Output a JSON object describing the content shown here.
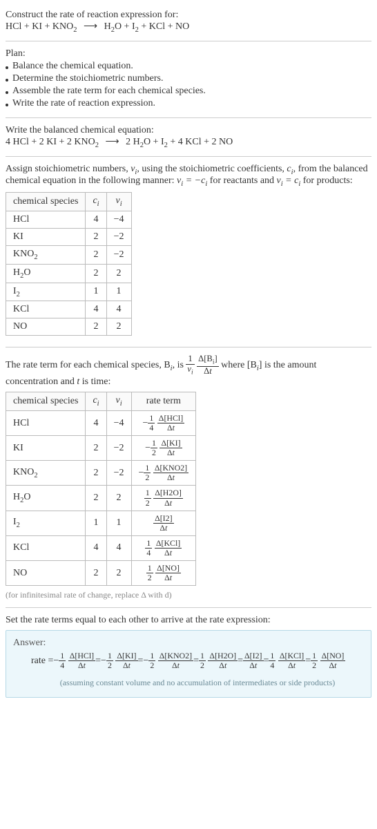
{
  "header": {
    "prompt": "Construct the rate of reaction expression for:",
    "equation_left": "HCl + KI + KNO",
    "equation_left_sub": "2",
    "equation_right_pre": "H",
    "equation_right_sub1": "2",
    "equation_right_mid1": "O + I",
    "equation_right_sub2": "2",
    "equation_right_mid2": " + KCl + NO"
  },
  "plan": {
    "title": "Plan:",
    "items": [
      "Balance the chemical equation.",
      "Determine the stoichiometric numbers.",
      "Assemble the rate term for each chemical species.",
      "Write the rate of reaction expression."
    ]
  },
  "balanced": {
    "title": "Write the balanced chemical equation:",
    "left": "4 HCl + 2 KI + 2 KNO",
    "left_sub": "2",
    "right_pre": "2 H",
    "right_sub1": "2",
    "right_mid1": "O + I",
    "right_sub2": "2",
    "right_mid2": " + 4 KCl + 2 NO"
  },
  "stoich_intro": {
    "line1_a": "Assign stoichiometric numbers, ",
    "line1_b": ", using the stoichiometric coefficients, ",
    "line1_c": ", from",
    "line2_a": "the balanced chemical equation in the following manner: ",
    "line2_b": " for reactants",
    "line3_a": "and ",
    "line3_b": " for products:",
    "nu_i": "ν",
    "nu_i_sub": "i",
    "c_i": "c",
    "c_i_sub": "i",
    "rel_reactants_lhs": "ν",
    "rel_reactants_lhs_sub": "i",
    "rel_reactants_eq": " = −",
    "rel_reactants_rhs": "c",
    "rel_reactants_rhs_sub": "i",
    "rel_products_lhs": "ν",
    "rel_products_lhs_sub": "i",
    "rel_products_eq": " = ",
    "rel_products_rhs": "c",
    "rel_products_rhs_sub": "i"
  },
  "table1": {
    "headers": {
      "species": "chemical species",
      "c": "c",
      "c_sub": "i",
      "nu": "ν",
      "nu_sub": "i"
    },
    "rows": [
      {
        "species": "HCl",
        "sub": "",
        "c": "4",
        "nu": "−4"
      },
      {
        "species": "KI",
        "sub": "",
        "c": "2",
        "nu": "−2"
      },
      {
        "species": "KNO",
        "sub": "2",
        "c": "2",
        "nu": "−2"
      },
      {
        "species": "H",
        "sub": "2",
        "suffix": "O",
        "c": "2",
        "nu": "2"
      },
      {
        "species": "I",
        "sub": "2",
        "c": "1",
        "nu": "1"
      },
      {
        "species": "KCl",
        "sub": "",
        "c": "4",
        "nu": "4"
      },
      {
        "species": "NO",
        "sub": "",
        "c": "2",
        "nu": "2"
      }
    ]
  },
  "rate_intro": {
    "pre": "The rate term for each chemical species, B",
    "pre_sub": "i",
    "mid": ", is ",
    "where": " where [B",
    "where_sub": "i",
    "where2": "] is the amount",
    "line2_a": "concentration and ",
    "line2_t": "t",
    "line2_b": " is time:",
    "frac_num1": "1",
    "frac_den1_nu": "ν",
    "frac_den1_sub": "i",
    "frac_num2_pre": "Δ[B",
    "frac_num2_sub": "i",
    "frac_num2_post": "]",
    "frac_den2_d": "Δ",
    "frac_den2_t": "t"
  },
  "table2": {
    "headers": {
      "species": "chemical species",
      "c": "c",
      "c_sub": "i",
      "nu": "ν",
      "nu_sub": "i",
      "rate": "rate term"
    },
    "rows": [
      {
        "species": "HCl",
        "sub": "",
        "c": "4",
        "nu": "−4",
        "sign": "−",
        "fnum": "1",
        "fden": "4",
        "conc": "Δ[HCl]"
      },
      {
        "species": "KI",
        "sub": "",
        "c": "2",
        "nu": "−2",
        "sign": "−",
        "fnum": "1",
        "fden": "2",
        "conc": "Δ[KI]"
      },
      {
        "species": "KNO",
        "sub": "2",
        "c": "2",
        "nu": "−2",
        "sign": "−",
        "fnum": "1",
        "fden": "2",
        "conc": "Δ[KNO2]"
      },
      {
        "species": "H",
        "sub": "2",
        "suffix": "O",
        "c": "2",
        "nu": "2",
        "sign": "",
        "fnum": "1",
        "fden": "2",
        "conc": "Δ[H2O]"
      },
      {
        "species": "I",
        "sub": "2",
        "c": "1",
        "nu": "1",
        "sign": "",
        "fnum": "",
        "fden": "",
        "conc": "Δ[I2]"
      },
      {
        "species": "KCl",
        "sub": "",
        "c": "4",
        "nu": "4",
        "sign": "",
        "fnum": "1",
        "fden": "4",
        "conc": "Δ[KCl]"
      },
      {
        "species": "NO",
        "sub": "",
        "c": "2",
        "nu": "2",
        "sign": "",
        "fnum": "1",
        "fden": "2",
        "conc": "Δ[NO]"
      }
    ],
    "dt_d": "Δ",
    "dt_t": "t"
  },
  "note_infinitesimal": "(for infinitesimal rate of change, replace Δ with d)",
  "final_intro": "Set the rate terms equal to each other to arrive at the rate expression:",
  "answer": {
    "title": "Answer:",
    "rate_label": "rate = ",
    "terms": [
      {
        "sign": "−",
        "fnum": "1",
        "fden": "4",
        "conc": "Δ[HCl]"
      },
      {
        "sign": "−",
        "fnum": "1",
        "fden": "2",
        "conc": "Δ[KI]"
      },
      {
        "sign": "−",
        "fnum": "1",
        "fden": "2",
        "conc": "Δ[KNO2]"
      },
      {
        "sign": "",
        "fnum": "1",
        "fden": "2",
        "conc": "Δ[H2O]"
      },
      {
        "sign": "",
        "fnum": "",
        "fden": "",
        "conc": "Δ[I2]"
      },
      {
        "sign": "",
        "fnum": "1",
        "fden": "4",
        "conc": "Δ[KCl]"
      },
      {
        "sign": "",
        "fnum": "1",
        "fden": "2",
        "conc": "Δ[NO]"
      }
    ],
    "dt_d": "Δ",
    "dt_t": "t",
    "eq": " = ",
    "footnote": "(assuming constant volume and no accumulation of intermediates or side products)"
  }
}
